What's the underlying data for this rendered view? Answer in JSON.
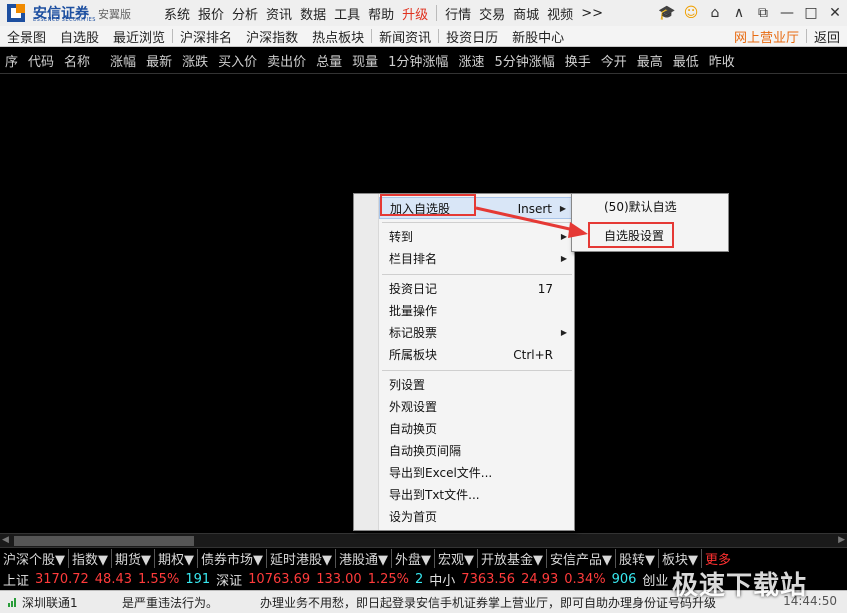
{
  "app": {
    "brand": "安信证券",
    "brand_en": "ESSENCE SECURITIES",
    "edition": "安翼版",
    "colors": {
      "brand": "#1d4fa0",
      "accent": "#e0301e",
      "annotation": "#e53935"
    }
  },
  "menu": {
    "items": [
      "系统",
      "报价",
      "分析",
      "资讯",
      "数据",
      "工具",
      "帮助",
      "升级"
    ],
    "items2": [
      "行情",
      "交易",
      "商城",
      "视频",
      ">>"
    ]
  },
  "toolbar": {
    "items": [
      "全景图",
      "自选股",
      "最近浏览",
      "沪深排名",
      "沪深指数",
      "热点板块",
      "新闻资讯",
      "投资日历",
      "新股中心"
    ],
    "online_hall": "网上营业厅",
    "back": "返回"
  },
  "columns": [
    "序",
    "代码",
    "名称",
    "涨幅",
    "最新",
    "涨跌",
    "买入价",
    "卖出价",
    "总量",
    "现量",
    "1分钟涨幅",
    "涨速",
    "5分钟涨幅",
    "换手",
    "今开",
    "最高",
    "最低",
    "昨收"
  ],
  "context_menu": {
    "add_favorite": "加入自选股",
    "add_favorite_shortcut": "Insert",
    "goto": "转到",
    "sort_column": "栏目排名",
    "journal": "投资日记",
    "journal_shortcut": "17",
    "batch": "批量操作",
    "mark": "标记股票",
    "sector": "所属板块",
    "sector_shortcut": "Ctrl+R",
    "col_settings": "列设置",
    "appearance": "外观设置",
    "auto_page": "自动换页",
    "auto_page_interval": "自动换页间隔",
    "export_excel": "导出到Excel文件...",
    "export_txt": "导出到Txt文件...",
    "set_home": "设为首页"
  },
  "submenu": {
    "default_fav": "(50)默认自选",
    "fav_settings": "自选股设置"
  },
  "category_tabs": [
    "沪深个股▼",
    "指数▼",
    "期货▼",
    "期权▼",
    "债券市场▼",
    "延时港股▼",
    "港股通▼",
    "外盘▼",
    "宏观▼",
    "开放基金▼",
    "安信产品▼",
    "股转▼",
    "板块▼"
  ],
  "category_more": "更多",
  "ticker": {
    "sh_label": "上证",
    "sh_value": "3170.72",
    "sh_change": "48.43",
    "sh_pct": "1.55%",
    "sh_vol": "191",
    "sz_label": "深证",
    "sz_value": "10763.69",
    "sz_change": "133.00",
    "sz_pct": "1.25%",
    "sz_vol": "2",
    "zx_label": "中小",
    "zx_value": "7363.56",
    "zx_change": "24.93",
    "zx_pct": "0.34%",
    "zx_vol": "906",
    "cy_label": "创业"
  },
  "status": {
    "connect": "深圳联通1",
    "msg1": "是严重违法行为。",
    "msg2": "办理业务不用愁，即日起登录安信手机证券掌上营业厅，即可自助办理身份证号码升级",
    "time": "14:44:50"
  },
  "watermark": "极速下载站"
}
